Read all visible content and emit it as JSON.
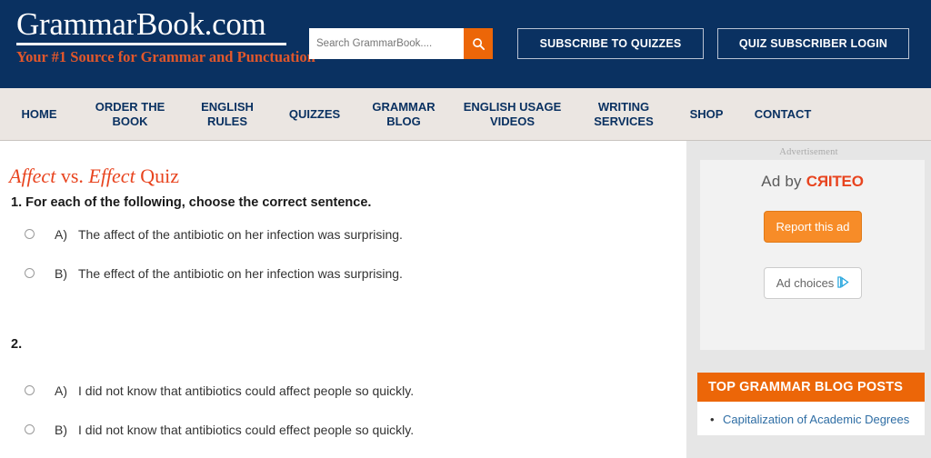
{
  "header": {
    "logo_title": "GrammarBook.com",
    "logo_tagline": "Your #1 Source for Grammar and Punctuation",
    "search": {
      "placeholder": "Search GrammarBook....",
      "value": "",
      "icon": "search-icon"
    },
    "subscribe_label": "SUBSCRIBE TO QUIZZES",
    "login_label": "QUIZ SUBSCRIBER LOGIN",
    "bg_color": "#0a3161",
    "accent_color": "#ec6608"
  },
  "nav": {
    "items": [
      {
        "label": "HOME"
      },
      {
        "label": "ORDER THE\nBOOK"
      },
      {
        "label": "ENGLISH\nRULES"
      },
      {
        "label": "QUIZZES"
      },
      {
        "label": "GRAMMAR\nBLOG"
      },
      {
        "label": "ENGLISH USAGE\nVIDEOS"
      },
      {
        "label": "WRITING\nSERVICES"
      },
      {
        "label": "SHOP"
      },
      {
        "label": "CONTACT"
      }
    ],
    "bg_color": "#ebe6e2",
    "text_color": "#0a3161"
  },
  "main": {
    "title_part1": "Affect",
    "title_part2": " vs. ",
    "title_part3": "Effect",
    "title_part4": " Quiz",
    "title_color": "#e8441f",
    "questions": [
      {
        "number": "1.",
        "prompt": "1. For each of the following, choose the correct sentence.",
        "options": [
          {
            "letter": "A)",
            "text": "The affect of the antibiotic on her infection was surprising.",
            "selected": false
          },
          {
            "letter": "B)",
            "text": "The effect of the antibiotic on her infection was surprising.",
            "selected": false
          }
        ]
      },
      {
        "number": "2.",
        "prompt": "2.",
        "options": [
          {
            "letter": "A)",
            "text": "I did not know that antibiotics could affect people so quickly.",
            "selected": false
          },
          {
            "letter": "B)",
            "text": "I did not know that antibiotics could effect people so quickly.",
            "selected": false
          }
        ]
      }
    ]
  },
  "sidebar": {
    "ad_label": "Advertisement",
    "ad": {
      "by_prefix": "Ad by ",
      "brand_c": "C",
      "brand_r": "R",
      "brand_rest": "ITEO",
      "report_label": "Report this ad",
      "choices_label": "Ad choices",
      "choices_icon": "adchoices-triangle-icon",
      "report_color": "#f78c28"
    },
    "blog": {
      "heading": "TOP GRAMMAR BLOG POSTS",
      "heading_color": "#ec6608",
      "posts": [
        {
          "label": "Capitalization of Academic Degrees"
        }
      ],
      "link_color": "#2e6da4"
    }
  }
}
